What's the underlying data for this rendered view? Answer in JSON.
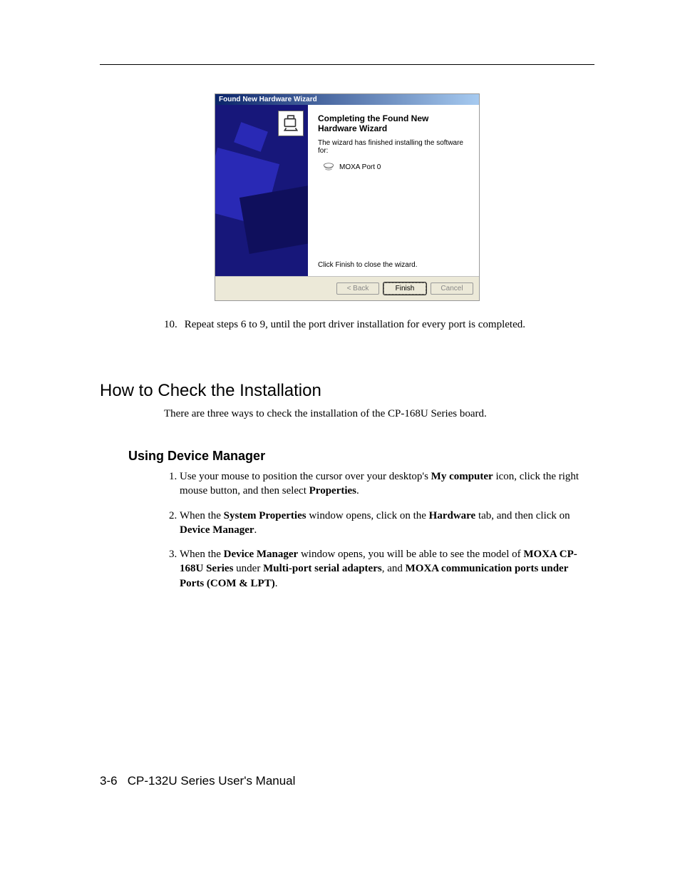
{
  "wizard": {
    "window_title": "Found New Hardware Wizard",
    "heading": "Completing the Found New Hardware Wizard",
    "description": "The wizard has finished installing the software for:",
    "device_name": "MOXA Port 0",
    "footnote": "Click Finish to close the wizard.",
    "buttons": {
      "back": "< Back",
      "finish": "Finish",
      "cancel": "Cancel"
    }
  },
  "step10": {
    "number": "10.",
    "text": "Repeat steps 6 to 9, until the port driver installation for every port is completed."
  },
  "section_heading": "How to Check the Installation",
  "section_intro": "There are three ways to check the installation of the CP-168U Series board.",
  "subsection_heading": "Using Device Manager",
  "steps": {
    "s1a": "Use your mouse to position the cursor over your desktop's ",
    "s1b": "My computer",
    "s1c": " icon, click the right mouse button, and then select ",
    "s1d": "Properties",
    "s1e": ".",
    "s2a": "When the ",
    "s2b": "System Properties",
    "s2c": " window opens, click on the ",
    "s2d": "Hardware",
    "s2e": " tab, and then click on ",
    "s2f": "Device Manager",
    "s2g": ".",
    "s3a": "When the ",
    "s3b": "Device Manager",
    "s3c": " window opens, you will be able to see the model of ",
    "s3d": "MOXA CP-168U Series",
    "s3e": " under ",
    "s3f": "Multi-port serial adapters",
    "s3g": ", and ",
    "s3h": "MOXA communication ports under Ports (COM & LPT)",
    "s3i": "."
  },
  "footer": {
    "page_num": "3-6",
    "manual_title": "CP-132U Series User's Manual"
  }
}
